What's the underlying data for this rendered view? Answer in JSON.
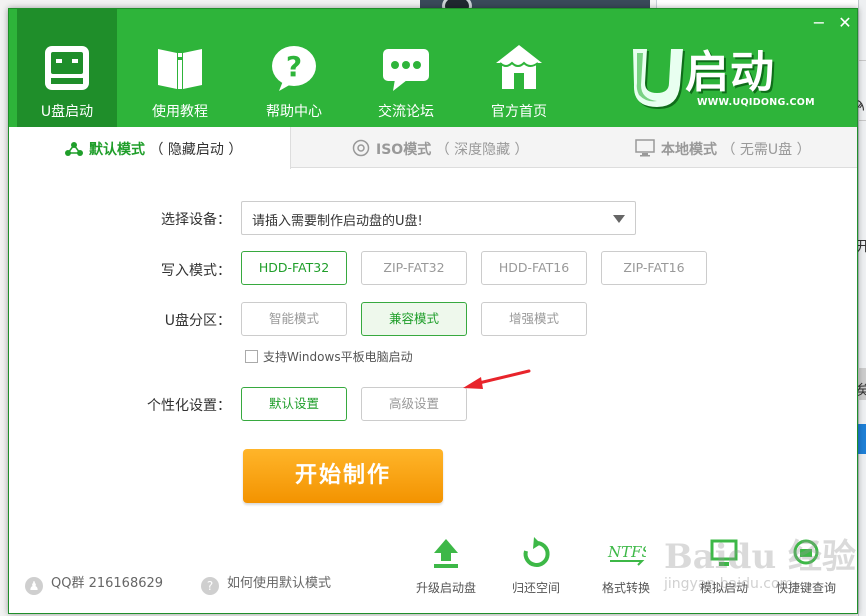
{
  "window": {
    "minimize_glyph": "−",
    "close_glyph": "✕"
  },
  "nav": [
    {
      "label": "U盘启动",
      "icon": "usb-drive-icon",
      "active": true
    },
    {
      "label": "使用教程",
      "icon": "book-icon",
      "active": false
    },
    {
      "label": "帮助中心",
      "icon": "question-bubble-icon",
      "active": false
    },
    {
      "label": "交流论坛",
      "icon": "chat-bubble-icon",
      "active": false
    },
    {
      "label": "官方首页",
      "icon": "home-icon",
      "active": false
    }
  ],
  "logo": {
    "text": "启动",
    "letter": "U",
    "url": "WWW.UQIDONG.COM"
  },
  "tabs": [
    {
      "label": "默认模式",
      "sub": "（ 隐藏启动 ）",
      "icon": "share-nodes-icon",
      "active": true
    },
    {
      "label": "ISO模式",
      "sub": "（ 深度隐藏 ）",
      "icon": "disc-icon",
      "active": false
    },
    {
      "label": "本地模式",
      "sub": "（ 无需U盘 ）",
      "icon": "monitor-icon",
      "active": false
    }
  ],
  "form": {
    "device_label": "选择设备：",
    "device_value": "请插入需要制作启动盘的U盘!",
    "write_label": "写入模式：",
    "write_options": [
      "HDD-FAT32",
      "ZIP-FAT32",
      "HDD-FAT16",
      "ZIP-FAT16"
    ],
    "write_selected": "HDD-FAT32",
    "partition_label": "U盘分区：",
    "partition_options": [
      "智能模式",
      "兼容模式",
      "增强模式"
    ],
    "partition_selected": "兼容模式",
    "windows_checkbox_label": "支持Windows平板电脑启动",
    "windows_checkbox_checked": false,
    "personal_label": "个性化设置：",
    "personal_options": [
      "默认设置",
      "高级设置"
    ],
    "personal_selected": "默认设置",
    "start_button": "开始制作"
  },
  "footer": {
    "qq_text": "QQ群 216168629",
    "help_text": "如何使用默认模式",
    "tools": [
      {
        "label": "升级启动盘",
        "icon": "upload-arrow-icon"
      },
      {
        "label": "归还空间",
        "icon": "restore-icon"
      },
      {
        "label": "格式转换",
        "icon": "ntfs-icon"
      },
      {
        "label": "模拟启动",
        "icon": "simulate-icon"
      },
      {
        "label": "快捷键查询",
        "icon": "keyboard-icon"
      }
    ]
  },
  "watermark": {
    "text": "Baidu 经验",
    "url": "jingyan.baidu.com"
  },
  "desktop": {
    "edge_char_1": "ϡ",
    "edge_char_2": "矣",
    "edge_char_3": "开"
  },
  "colors": {
    "header_green": "#2eb43a",
    "active_nav_green": "#1f8e2a",
    "selected_green": "#1f9e2a",
    "start_orange": "#f39300",
    "annotation_red": "#e8242b"
  }
}
